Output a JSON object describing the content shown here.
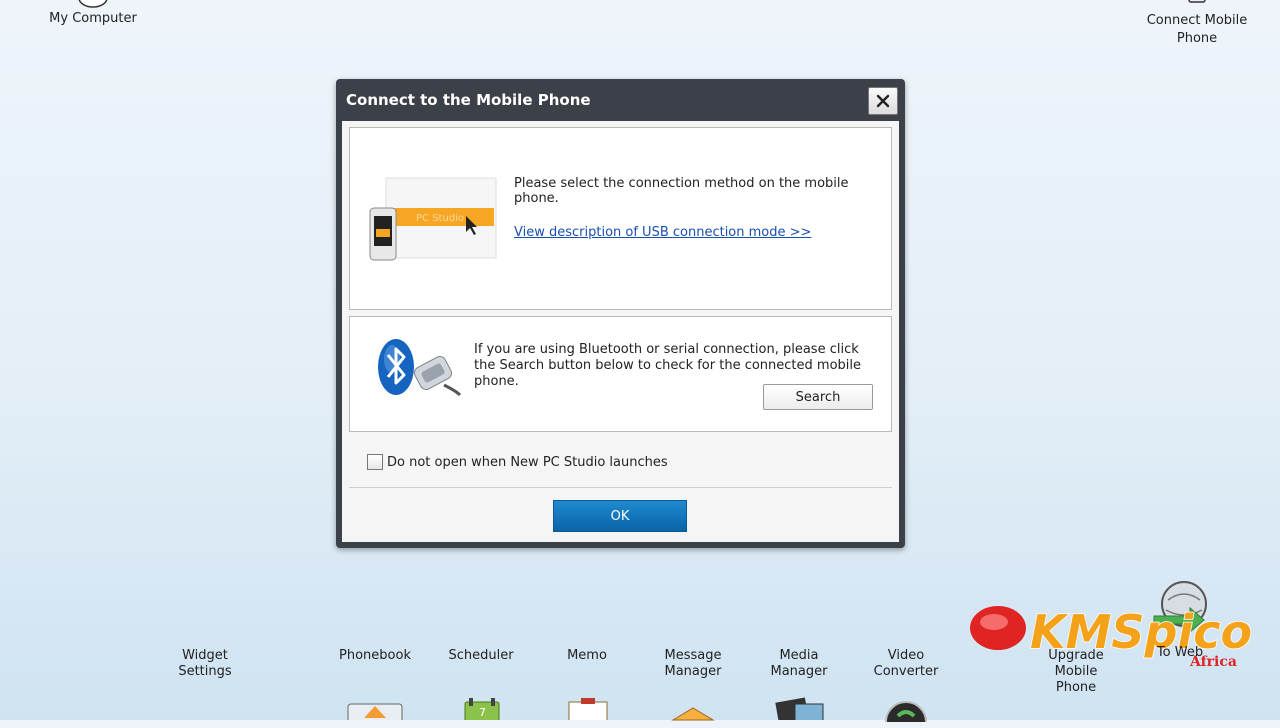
{
  "desktop": {
    "my_computer": "My Computer",
    "connect_mobile": "Connect Mobile\nPhone"
  },
  "dialog": {
    "title": "Connect to the Mobile Phone",
    "usb": {
      "instruction": "Please select the connection method on the mobile phone.",
      "link": "View description of USB connection mode >>",
      "illustration_text": "PC Studio"
    },
    "bluetooth": {
      "text": "If you are using Bluetooth or serial connection, please click the Search button below to check for the connected mobile phone.",
      "search_label": "Search"
    },
    "checkbox_label": "Do not open when New PC Studio launches",
    "checkbox_checked": false,
    "ok_label": "OK"
  },
  "toolbar": {
    "items": [
      {
        "label": "Widget\nSettings",
        "icon": "widget-icon"
      },
      {
        "label": "Phonebook",
        "icon": "phonebook-icon"
      },
      {
        "label": "Scheduler",
        "icon": "scheduler-icon"
      },
      {
        "label": "Memo",
        "icon": "memo-icon"
      },
      {
        "label": "Message\nManager",
        "icon": "message-icon"
      },
      {
        "label": "Media\nManager",
        "icon": "media-icon"
      },
      {
        "label": "Video\nConverter",
        "icon": "video-icon"
      },
      {
        "label": "Upgrade\nMobile\nPhone",
        "icon": "upgrade-icon"
      },
      {
        "label": "To Web",
        "icon": "globe-icon"
      }
    ]
  },
  "watermark": {
    "text": "KMSpico",
    "subtext": "Africa"
  },
  "colors": {
    "ok_button": "#0f72b8",
    "link": "#1a4fb0",
    "titlebar": "#3c4048",
    "watermark": "#f4a21a"
  }
}
